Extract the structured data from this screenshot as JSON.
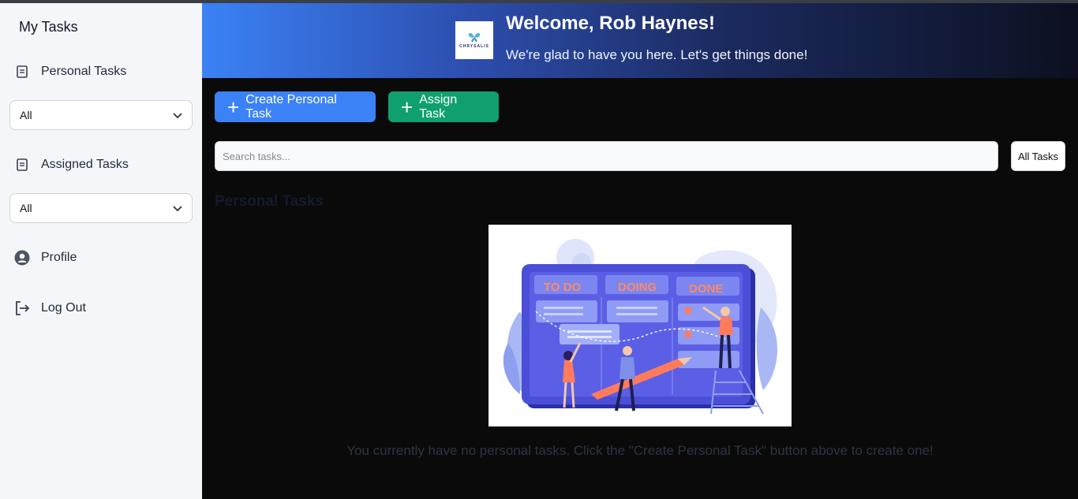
{
  "sidebar": {
    "title": "My Tasks",
    "personal_label": "Personal Tasks",
    "personal_filter": "All",
    "assigned_label": "Assigned Tasks",
    "assigned_filter": "All",
    "profile_label": "Profile",
    "logout_label": "Log Out"
  },
  "header": {
    "logo_text": "CHRYSALIS",
    "welcome": "Welcome, Rob Haynes!",
    "subtitle": "We're glad to have you here. Let's get things done!"
  },
  "actions": {
    "create_label": "Create Personal Task",
    "assign_label": "Assign Task"
  },
  "search": {
    "placeholder": "Search tasks...",
    "filter_label": "All Tasks"
  },
  "main": {
    "section_title": "Personal Tasks",
    "board_columns": [
      "TO DO",
      "DOING",
      "DONE"
    ],
    "empty_message": "You currently have no personal tasks. Click the \"Create Personal Task\" button above to create one!"
  },
  "colors": {
    "primary": "#3b82f6",
    "success": "#10a070",
    "background": "#0a0a0a",
    "sidebar": "#f5f6fa"
  }
}
